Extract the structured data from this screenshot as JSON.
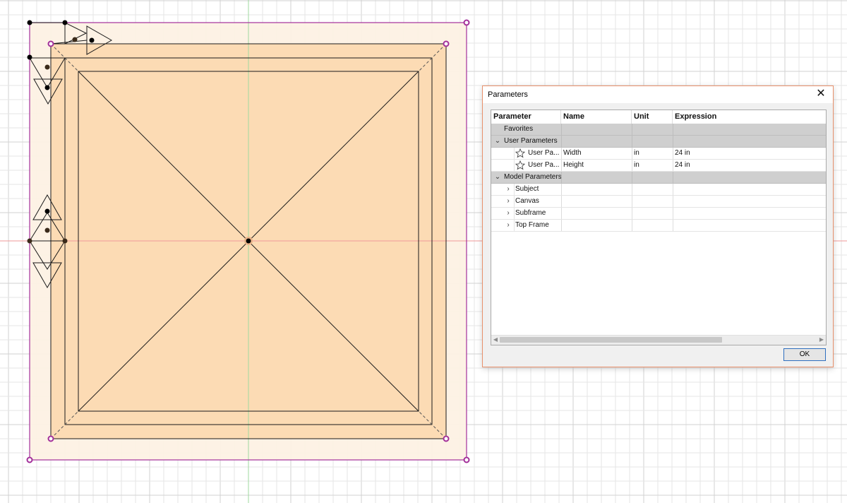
{
  "dialog": {
    "title": "Parameters",
    "close_glyph": "✕",
    "ok_label": "OK",
    "columns": [
      "Parameter",
      "Name",
      "Unit",
      "Expression"
    ],
    "rows": [
      {
        "kind": "group",
        "expander": "",
        "label": "Favorites",
        "name": "",
        "unit": "",
        "expr": ""
      },
      {
        "kind": "group",
        "expander": "⌄",
        "label": "User Parameters",
        "name": "",
        "unit": "",
        "expr": ""
      },
      {
        "kind": "param",
        "icon": "star-icon",
        "label": "User Pa...",
        "name": "Width",
        "unit": "in",
        "expr": "24 in"
      },
      {
        "kind": "param",
        "icon": "star-icon",
        "label": "User Pa...",
        "name": "Height",
        "unit": "in",
        "expr": "24 in"
      },
      {
        "kind": "group",
        "expander": "⌄",
        "label": "Model Parameters",
        "name": "",
        "unit": "",
        "expr": ""
      },
      {
        "kind": "child",
        "expander": "›",
        "label": "Subject",
        "name": "",
        "unit": "",
        "expr": ""
      },
      {
        "kind": "child",
        "expander": "›",
        "label": "Canvas",
        "name": "",
        "unit": "",
        "expr": ""
      },
      {
        "kind": "child",
        "expander": "›",
        "label": "Subframe",
        "name": "",
        "unit": "",
        "expr": ""
      },
      {
        "kind": "child",
        "expander": "›",
        "label": "Top Frame",
        "name": "",
        "unit": "",
        "expr": ""
      }
    ],
    "scroll_left": "◀",
    "scroll_right": "▶"
  },
  "colors": {
    "fill_outer": "#fdf1e4",
    "fill_inner": "#fcd9b1",
    "outline": "#1a1a1a",
    "boundary": "#a3309a",
    "grid_minor": "#e6e6e6",
    "grid_major": "#d2d2d2",
    "axis_x": "#ef9a9a",
    "axis_y": "#9fd89f",
    "dialog_border": "#e8916c"
  }
}
